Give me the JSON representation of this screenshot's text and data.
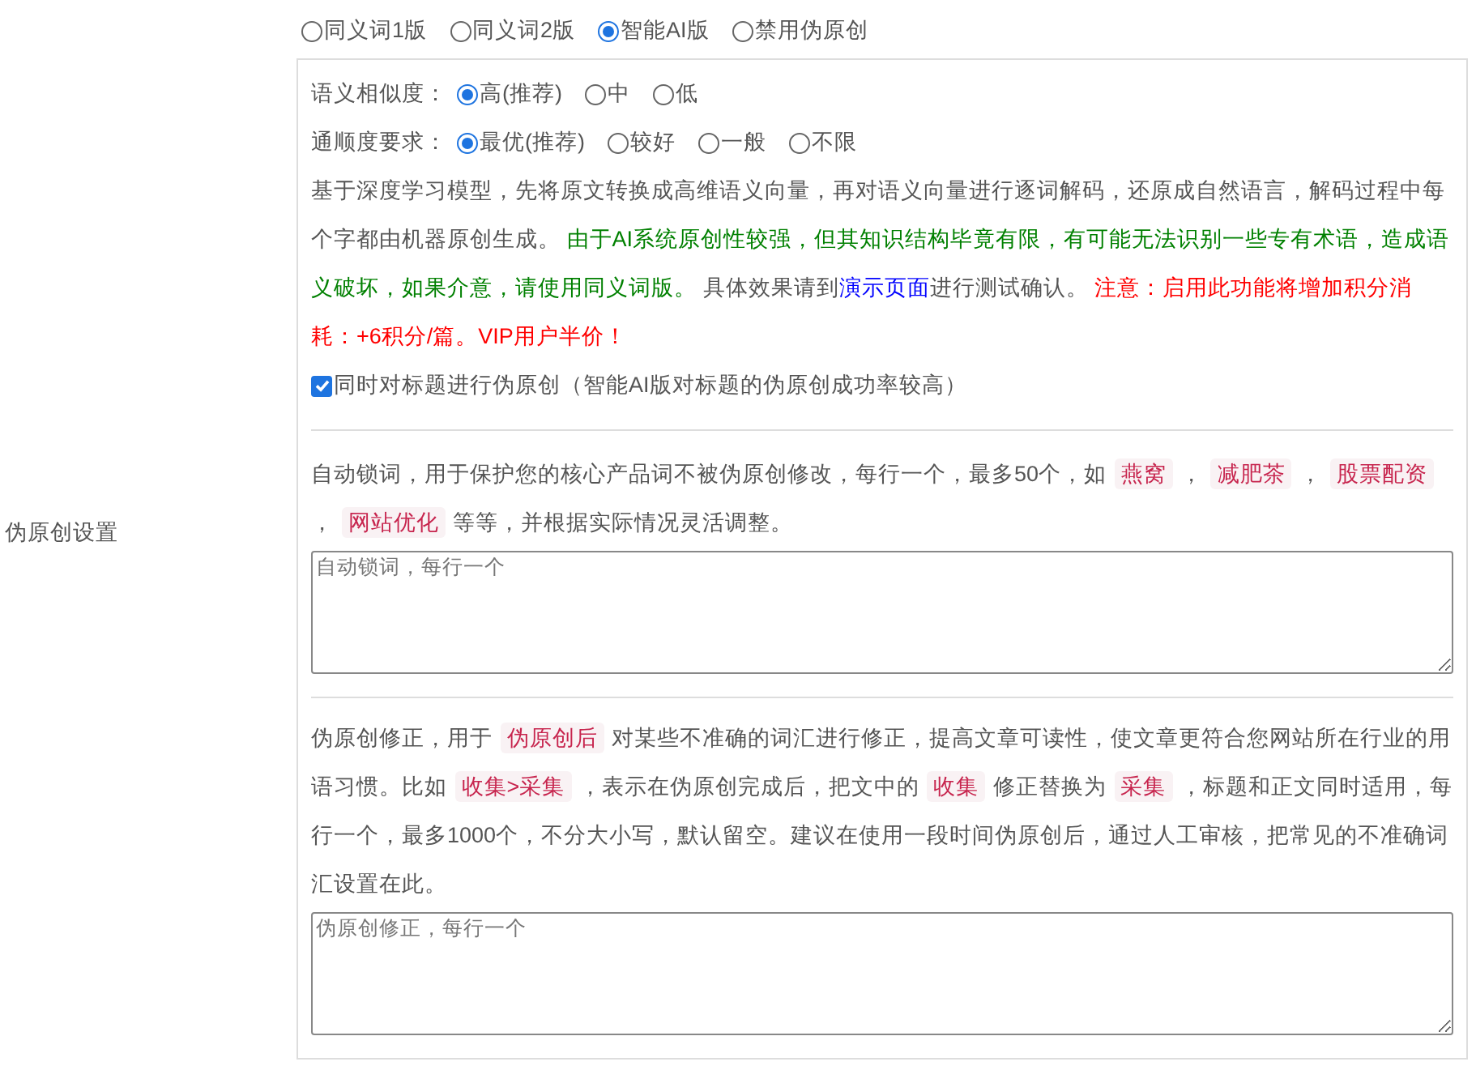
{
  "mode_options": [
    {
      "label": "同义词1版",
      "selected": false
    },
    {
      "label": "同义词2版",
      "selected": false
    },
    {
      "label": "智能AI版",
      "selected": true
    },
    {
      "label": "禁用伪原创",
      "selected": false
    }
  ],
  "ai_panel": {
    "similarity": {
      "label": "语义相似度：",
      "options": [
        {
          "label": "高(推荐)",
          "selected": true
        },
        {
          "label": "中",
          "selected": false
        },
        {
          "label": "低",
          "selected": false
        }
      ]
    },
    "fluency": {
      "label": "通顺度要求：",
      "options": [
        {
          "label": "最优(推荐)",
          "selected": true
        },
        {
          "label": "较好",
          "selected": false
        },
        {
          "label": "一般",
          "selected": false
        },
        {
          "label": "不限",
          "selected": false
        }
      ]
    },
    "description": [
      {
        "kind": "plain",
        "text": "基于深度学习模型，先将原文转换成高维语义向量，再对语义向量进行逐词解码，还原成自然语言，解码过程中每个字都由机器原创生成。 "
      },
      {
        "kind": "green",
        "text": "由于AI系统原创性较强，但其知识结构毕竟有限，有可能无法识别一些专有术语，造成语义破坏，如果介意，请使用同义词版。"
      },
      {
        "kind": "plain",
        "text": " 具体效果请到"
      },
      {
        "kind": "link",
        "text": "演示页面"
      },
      {
        "kind": "plain",
        "text": "进行测试确认。 "
      },
      {
        "kind": "red",
        "text": "注意：启用此功能将增加积分消耗：+6积分/篇。VIP用户半价！"
      }
    ],
    "title_option": {
      "label": "同时对标题进行伪原创（智能AI版对标题的伪原创成功率较高）",
      "checked": true
    }
  },
  "side_label": "伪原创设置",
  "lock_section": {
    "description": [
      {
        "kind": "plain",
        "text": "自动锁词，用于保护您的核心产品词不被伪原创修改，每行一个，最多50个，如 "
      },
      {
        "kind": "tag",
        "text": "燕窝"
      },
      {
        "kind": "plain",
        "text": " ， "
      },
      {
        "kind": "tag",
        "text": "减肥茶"
      },
      {
        "kind": "plain",
        "text": " ， "
      },
      {
        "kind": "tag",
        "text": "股票配资"
      },
      {
        "kind": "plain",
        "text": " ， "
      },
      {
        "kind": "tag",
        "text": "网站优化"
      },
      {
        "kind": "plain",
        "text": " 等等，并根据实际情况灵活调整。"
      }
    ],
    "placeholder": "自动锁词，每行一个"
  },
  "correction_section": {
    "description": [
      {
        "kind": "plain",
        "text": "伪原创修正，用于 "
      },
      {
        "kind": "tag",
        "text": "伪原创后"
      },
      {
        "kind": "plain",
        "text": " 对某些不准确的词汇进行修正，提高文章可读性，使文章更符合您网站所在行业的用语习惯。比如 "
      },
      {
        "kind": "tag",
        "text": "收集>采集"
      },
      {
        "kind": "plain",
        "text": " ，表示在伪原创完成后，把文中的 "
      },
      {
        "kind": "tag",
        "text": "收集"
      },
      {
        "kind": "plain",
        "text": " 修正替换为 "
      },
      {
        "kind": "tag",
        "text": "采集"
      },
      {
        "kind": "plain",
        "text": " ，标题和正文同时适用，每行一个，最多1000个，不分大小写，默认留空。建议在使用一段时间伪原创后，通过人工审核，把常见的不准确词汇设置在此。"
      }
    ],
    "placeholder": "伪原创修正，每行一个"
  }
}
